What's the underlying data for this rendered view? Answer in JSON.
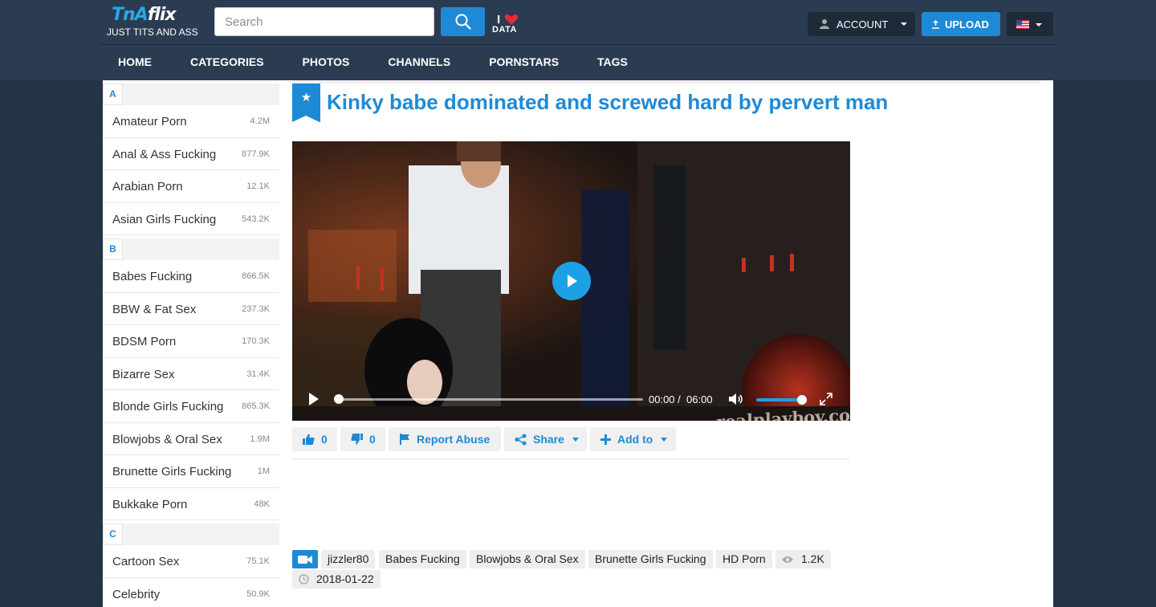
{
  "header": {
    "logo_text_1": "TnA",
    "logo_text_2": "flix",
    "tagline": "JUST TITS AND ASS",
    "search_placeholder": "Search",
    "ilove_i": "I",
    "ilove_data": "DATA",
    "account_label": "ACCOUNT",
    "upload_label": "UPLOAD"
  },
  "nav": {
    "items": [
      "HOME",
      "CATEGORIES",
      "PHOTOS",
      "CHANNELS",
      "PORNSTARS",
      "TAGS"
    ]
  },
  "sidebar": {
    "groups": [
      {
        "letter": "A",
        "items": [
          {
            "name": "Amateur Porn",
            "count": "4.2M"
          },
          {
            "name": "Anal & Ass Fucking",
            "count": "877.9K"
          },
          {
            "name": "Arabian Porn",
            "count": "12.1K"
          },
          {
            "name": "Asian Girls Fucking",
            "count": "543.2K"
          }
        ]
      },
      {
        "letter": "B",
        "items": [
          {
            "name": "Babes Fucking",
            "count": "866.5K"
          },
          {
            "name": "BBW & Fat Sex",
            "count": "237.3K"
          },
          {
            "name": "BDSM Porn",
            "count": "170.3K"
          },
          {
            "name": "Bizarre Sex",
            "count": "31.4K"
          },
          {
            "name": "Blonde Girls Fucking",
            "count": "865.3K"
          },
          {
            "name": "Blowjobs & Oral Sex",
            "count": "1.9M"
          },
          {
            "name": "Brunette Girls Fucking",
            "count": "1M"
          },
          {
            "name": "Bukkake Porn",
            "count": "48K"
          }
        ]
      },
      {
        "letter": "C",
        "items": [
          {
            "name": "Cartoon Sex",
            "count": "75.1K"
          },
          {
            "name": "Celebrity",
            "count": "50.9K"
          }
        ]
      }
    ]
  },
  "video": {
    "title": "Kinky babe dominated and screwed hard by pervert man",
    "current_time": "00:00",
    "time_sep": "/",
    "duration": "06:00",
    "watermark": "realplayboy.com",
    "progress": 0,
    "volume": 0.9
  },
  "actions": {
    "likes": "0",
    "dislikes": "0",
    "report_label": "Report Abuse",
    "share_label": "Share",
    "add_label": "Add to"
  },
  "meta": {
    "uploader": "jizzler80",
    "tags": [
      "Babes Fucking",
      "Blowjobs & Oral Sex",
      "Brunette Girls Fucking",
      "HD Porn"
    ],
    "views": "1.2K",
    "date": "2018-01-22"
  },
  "colors": {
    "accent": "#1e8ad6",
    "header_bg": "#2b3c52",
    "page_bg": "#243447"
  }
}
